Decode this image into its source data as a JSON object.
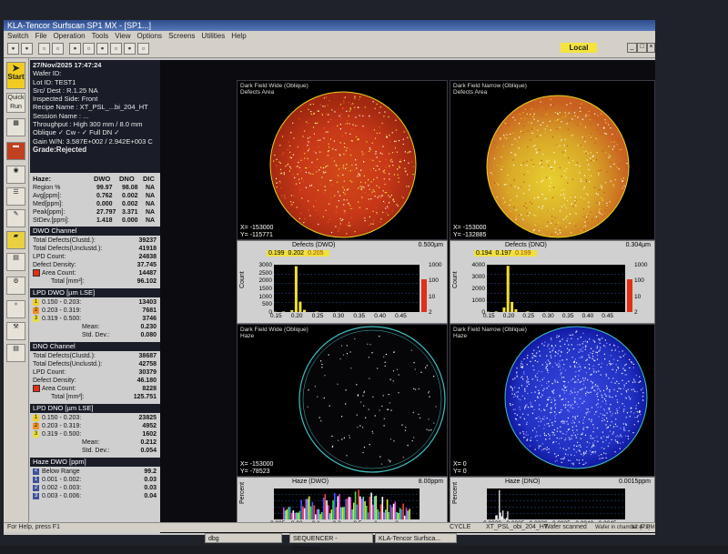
{
  "window": {
    "title": "KLA-Tencor  Surfscan SP1 MX - [SP1...]",
    "local_badge": "Local",
    "menu": [
      "Switch",
      "File",
      "Operation",
      "Tools",
      "View",
      "Options",
      "Screens",
      "Utilities",
      "Help"
    ]
  },
  "left_toolbar": {
    "start_label": "Start",
    "quick_label": "Quick Run"
  },
  "wafer_info": {
    "date": "27/Nov/2025  17:47:24",
    "wafer_id": "Wafer ID:",
    "lot_id": "Lot ID: TEST1",
    "slot_dest": "Src/ Dest : R.1.25      NA",
    "side": "Inspected Side: Front",
    "recipe": "Recipe Name : XT_PSL_...bi_204_HT",
    "session": "Session Name : ...",
    "throughput": "Throughput : High    300 mm / 8.0 mm",
    "oblique": "Oblique ✓ Cw - ✓ Full   DN ✓",
    "gain": "Gain W/N: 3.587E+002 / 2.942E+003 C",
    "grade": "Grade:Rejected"
  },
  "haze_table": {
    "header": [
      "Haze:",
      "DWO",
      "DNO",
      "DIC"
    ],
    "rows": [
      {
        "label": "Region %",
        "dwo": "99.97",
        "dno": "98.08",
        "dic": "NA"
      },
      {
        "label": "Avg[ppm]:",
        "dwo": "0.762",
        "dno": "0.002",
        "dic": "NA"
      },
      {
        "label": "Med[ppm]:",
        "dwo": "0.000",
        "dno": "0.002",
        "dic": "NA"
      },
      {
        "label": "Peak[ppm]:",
        "dwo": "27.797",
        "dno": "3.371",
        "dic": "NA"
      },
      {
        "label": "StDev.[ppm]:",
        "dwo": "1.418",
        "dno": "0.000",
        "dic": "NA"
      }
    ]
  },
  "dwo_channel": {
    "title": "DWO Channel",
    "rows": [
      {
        "label": "Total Defects(Clustd.):",
        "value": "39237"
      },
      {
        "label": "Total Defects(Unclustd.):",
        "value": "41918"
      },
      {
        "label": "LPD Count:",
        "value": "24838"
      },
      {
        "label": "Defect Density:",
        "value": "37.745"
      },
      {
        "label": "Area Count:",
        "value": "14487"
      },
      {
        "label": "Total [mm²]:",
        "value": "96.102"
      }
    ]
  },
  "lpd_dwo": {
    "title": "LPD DWO  [µm LSE]",
    "bins": [
      {
        "idx": "1",
        "range": "0.150 -    0.203:",
        "value": "13403",
        "color": "#f0d020"
      },
      {
        "idx": "2",
        "range": "0.203 -    0.319:",
        "value": "7681",
        "color": "#f09020"
      },
      {
        "idx": "3",
        "range": "0.319 -    0.500:",
        "value": "3746",
        "color": "#e8e040"
      }
    ],
    "mean_label": "Mean:",
    "mean": "0.230",
    "std_label": "Std. Dev.:",
    "std": "0.080"
  },
  "dno_channel": {
    "title": "DNO Channel",
    "rows": [
      {
        "label": "Total Defects(Clustd.):",
        "value": "38687"
      },
      {
        "label": "Total Defects(Unclustd.):",
        "value": "42758"
      },
      {
        "label": "LPD Count:",
        "value": "30379"
      },
      {
        "label": "Defect Density:",
        "value": "46.180"
      },
      {
        "label": "Area Count:",
        "value": "8228"
      },
      {
        "label": "Total [mm²]:",
        "value": "125.751"
      }
    ]
  },
  "lpd_dno": {
    "title": "LPD DNO  [µm LSE]",
    "bins": [
      {
        "idx": "1",
        "range": "0.150 -    0.203:",
        "value": "23825",
        "color": "#f0d020"
      },
      {
        "idx": "2",
        "range": "0.203 -    0.319:",
        "value": "4952",
        "color": "#f09020"
      },
      {
        "idx": "3",
        "range": "0.319 -    0.500:",
        "value": "1602",
        "color": "#e8e040"
      }
    ],
    "mean_label": "Mean:",
    "mean": "0.212",
    "std_label": "Std. Dev.:",
    "std": "0.054"
  },
  "haze_dwo_bins": {
    "title": "Haze DWO   [ppm]",
    "rows": [
      {
        "idx": "<",
        "range": "Below Range",
        "value": "99.2"
      },
      {
        "idx": "1",
        "range": "0.001 -     0.002:",
        "value": "0.03"
      },
      {
        "idx": "2",
        "range": "0.002 -     0.003:",
        "value": "0.03"
      },
      {
        "idx": "3",
        "range": "0.003 -     0.006:",
        "value": "0.04"
      }
    ]
  },
  "maps": {
    "dwo_label": "Dark Field Wide (Oblique)",
    "dwo_sub": "Defects Area",
    "dno_label": "Dark Field Narrow (Oblique)",
    "dno_sub": "Defects Area",
    "dwo_coord": [
      "X= -153000",
      "Y= -115771"
    ],
    "dno_coord": [
      "X= -153000",
      "Y= -132885"
    ],
    "haze_dwo_label": "Dark Field Wide (Oblique)",
    "haze_dwo_sub": "Haze",
    "haze_dno_label": "Dark Field Narrow (Oblique)",
    "haze_dno_sub": "Haze",
    "haze_dwo_coord": [
      "X= -153000",
      "Y= -78523"
    ],
    "haze_dno_coord": [
      "X=      0",
      "Y=      0"
    ]
  },
  "chart_data": [
    {
      "type": "bar",
      "title": "Defects (DWO)",
      "range_label": "0.500µm",
      "bin_values": [
        "0.199",
        "0.202",
        "0.205"
      ],
      "xlabel": "",
      "ylabel": "Count",
      "x_ticks": [
        "0.15",
        "0.20",
        "0.25",
        "0.30",
        "0.35",
        "0.40",
        "0.45"
      ],
      "y_ticks": [
        "3000",
        "2500",
        "2000",
        "1500",
        "1000",
        "500",
        "0"
      ],
      "right_ticks": [
        "1000",
        "100",
        "10",
        "2"
      ],
      "x": [
        0.15,
        0.17,
        0.19,
        0.2,
        0.21,
        0.22,
        0.25,
        0.3
      ],
      "values": [
        20,
        40,
        120,
        3100,
        700,
        150,
        30,
        10
      ],
      "xlim": [
        0.15,
        0.5
      ],
      "ylim": [
        0,
        3200
      ]
    },
    {
      "type": "bar",
      "title": "Defects (DNO)",
      "range_label": "0.304µm",
      "bin_values": [
        "0.194",
        "0.197",
        "0.199"
      ],
      "xlabel": "",
      "ylabel": "Count",
      "x_ticks": [
        "0.15",
        "0.20",
        "0.25",
        "0.30",
        "0.35",
        "0.40",
        "0.45"
      ],
      "y_ticks": [
        "4000",
        "3000",
        "2000",
        "1000",
        "0"
      ],
      "right_ticks": [
        "1000",
        "100",
        "10",
        "2"
      ],
      "x": [
        0.15,
        0.17,
        0.19,
        0.2,
        0.21,
        0.22,
        0.25,
        0.3
      ],
      "values": [
        30,
        60,
        400,
        4100,
        900,
        250,
        60,
        15
      ],
      "xlim": [
        0.15,
        0.5
      ],
      "ylim": [
        0,
        4200
      ]
    },
    {
      "type": "bar",
      "title": "Haze (DWO)",
      "range_label": "8.00ppm",
      "ylabel": "Percent",
      "x_ticks": [
        "0.005",
        "0.02",
        "0.1",
        "0.2",
        "0.5",
        "1",
        "2"
      ]
    },
    {
      "type": "bar",
      "title": "Haze (DNO)",
      "range_label": "0.0015ppm",
      "ylabel": "Percent",
      "x_ticks": [
        "0.0020",
        "0.0025",
        "0.0030",
        "0.0035",
        "0.0040",
        "0.0045"
      ]
    }
  ],
  "status": {
    "help": "For Help, press F1",
    "cycle": "CYCLE",
    "recipe": "XT_PSL_obi_204_HT",
    "wafer_state": "Wafer scanned",
    "chamber": "Wafer in chamber (P1)",
    "time": "12:47 PM"
  },
  "taskbar": {
    "items": [
      "dbg",
      "SEQUENCER - [Processi...",
      "KLA-Tencor  Surfsca..."
    ]
  },
  "colors": {
    "defect_red": "#e03018",
    "defect_yellow": "#e8d020",
    "haze_blue": "#2030c8",
    "cyan_ring": "#40c0c0",
    "grade_highlight": "#f4e43c"
  }
}
